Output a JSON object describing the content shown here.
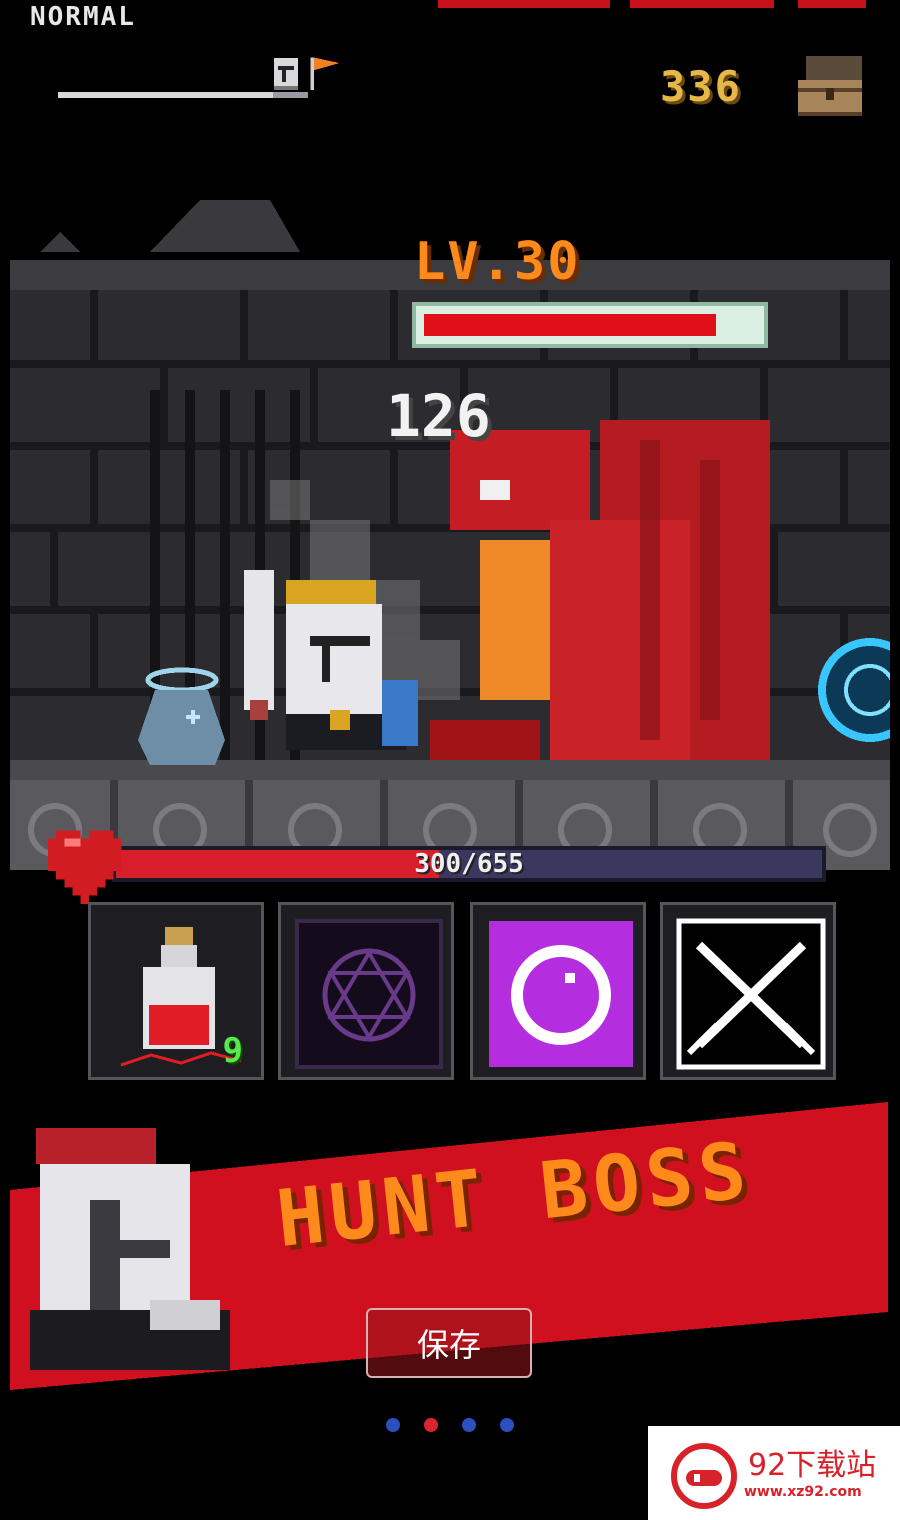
{
  "hud": {
    "difficulty": "NORMAL",
    "gold": "336",
    "stage_progress": 0.86
  },
  "boss": {
    "level_label": "LV.30",
    "hp_fraction": 0.88,
    "damage_popup": "126"
  },
  "player": {
    "hp_text": "300/655",
    "hp_current": 300,
    "hp_max": 655
  },
  "skills": [
    {
      "name": "health-potion",
      "count": "9"
    },
    {
      "name": "dark-rune"
    },
    {
      "name": "purple-orb"
    },
    {
      "name": "crossed-swords"
    }
  ],
  "banner": {
    "title": "HUNT BOSS",
    "save_label": "保存"
  },
  "pager": {
    "count": 4,
    "active_index": 1,
    "active_color": "#d8262e",
    "inactive_color": "#2b4fbf"
  },
  "watermark": {
    "title": "92下载站",
    "url": "www.xz92.com"
  },
  "colors": {
    "accent_orange": "#ff8a1c",
    "gold_text": "#e6b84a",
    "hp_red": "#d81e2a",
    "banner_red": "#d0101e"
  }
}
